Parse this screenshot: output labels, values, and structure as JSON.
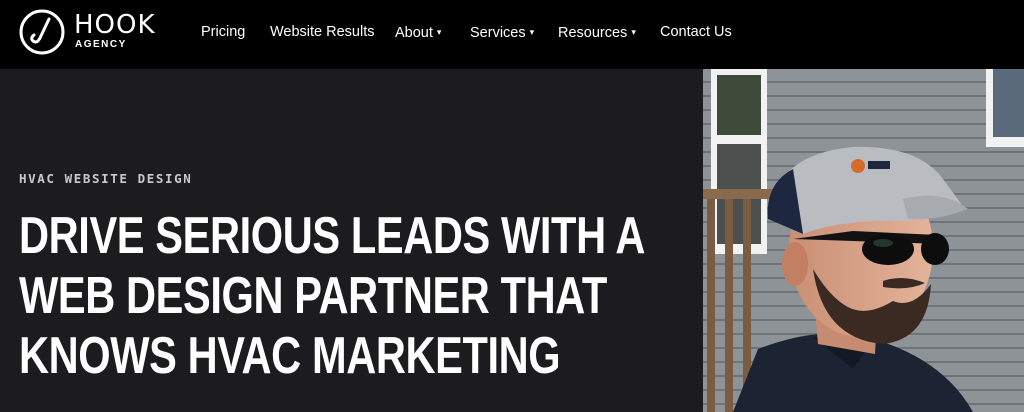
{
  "brand": {
    "name": "HOOK",
    "sub": "AGENCY"
  },
  "nav": {
    "items": [
      {
        "label": "Pricing",
        "dropdown": false
      },
      {
        "label": "Website Results",
        "dropdown": false
      },
      {
        "label": "About",
        "dropdown": true
      },
      {
        "label": "Services",
        "dropdown": true
      },
      {
        "label": "Resources",
        "dropdown": true
      },
      {
        "label": "Contact Us",
        "dropdown": false
      }
    ],
    "caret": "▾"
  },
  "hero": {
    "eyebrow": "HVAC WEBSITE DESIGN",
    "headline_lines": [
      "DRIVE SERIOUS LEADS WITH A",
      "WEB DESIGN PARTNER THAT",
      "KNOWS HVAC MARKETING"
    ]
  },
  "colors": {
    "nav_bg": "#000000",
    "hero_bg": "#1c1b1d",
    "text": "#ffffff",
    "eyebrow": "#c9c9cc",
    "siding": "#8e9398"
  }
}
